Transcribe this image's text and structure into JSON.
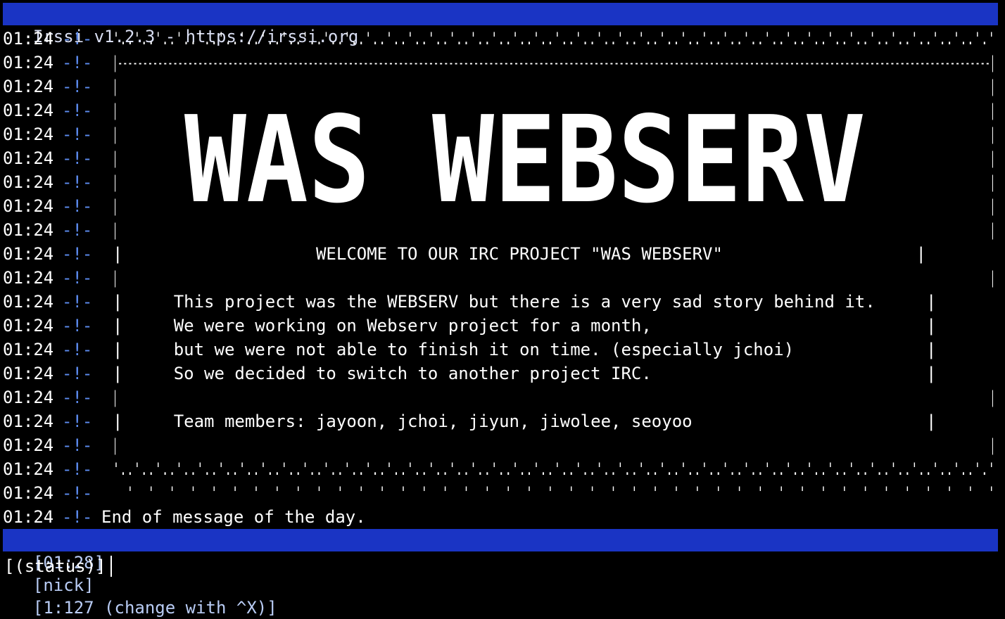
{
  "window": {
    "title": "Irssi v1.2.3 - https://irssi.org"
  },
  "log": {
    "symbol": "-!-",
    "lines": [
      {
        "time": "01:24",
        "text": "'..'..'..'..'..'..'..'..'..'..'..'..'..'..'..'..'..'..'..'..'..'..'..'..'..'..'..'..'..'..'..'..'..'..'..'..'..'..'..'..'..'.'"
      },
      {
        "time": "01:24",
        "text": "|------------------------------------------------------------------------------------------------------------------------------------------------------------------------------|"
      },
      {
        "time": "01:24",
        "text": "|                                                                                                                                                                              |"
      },
      {
        "time": "01:24",
        "text": "|                                                                                                                                                                              |"
      },
      {
        "time": "01:24",
        "text": "|                                                                                                                                                                              |"
      },
      {
        "time": "01:24",
        "text": "|                                                                                                                                                                              |"
      },
      {
        "time": "01:24",
        "text": "|                                                                                                                                                                              |"
      },
      {
        "time": "01:24",
        "text": "|                                                                                                                                                                              |"
      },
      {
        "time": "01:24",
        "text": "|                                                                                                                                                                              |"
      },
      {
        "time": "01:24",
        "text": "|                   WELCOME TO OUR IRC PROJECT \"WAS WEBSERV\"                   |"
      },
      {
        "time": "01:24",
        "text": "|                                                                                                                                                                              |"
      },
      {
        "time": "01:24",
        "text": "|     This project was the WEBSERV but there is a very sad story behind it.     |"
      },
      {
        "time": "01:24",
        "text": "|     We were working on Webserv project for a month,                           |"
      },
      {
        "time": "01:24",
        "text": "|     but we were not able to finish it on time. (especially jchoi)             |"
      },
      {
        "time": "01:24",
        "text": "|     So we decided to switch to another project IRC.                           |"
      },
      {
        "time": "01:24",
        "text": "|                                                                                                                                                                              |"
      },
      {
        "time": "01:24",
        "text": "|     Team members: jayoon, jchoi, jiyun, jiwolee, seoyoo                       |"
      },
      {
        "time": "01:24",
        "text": "|                                                                                                                                                                              |"
      },
      {
        "time": "01:24",
        "text": "'..'..'..'..'..'..'..'..'..'..'..'..'..'..'..'..'..'..'..'..'..'..'..'..'..'..'..'..'..'..'..'..'..'..'..'..'..'..'..'..'..'.'"
      },
      {
        "time": "01:24",
        "text": "  '  '  '  '  '  '  '  '  '  '  '  '  '  '  '  '  '  '  '  '  '  '  '  '  '  '  '  '  '  '  '  '  '  '  '  '  '  '  '  '  '  '"
      },
      {
        "time": "01:24",
        "text": "End of message of the day."
      }
    ]
  },
  "banner": {
    "text": "WAS WEBSERV"
  },
  "statusbar": {
    "clock": "[01:28]",
    "nick": "[nick]",
    "window": "[1:127 (change with ^X)]"
  },
  "input": {
    "prompt": "[(status)]"
  },
  "colors": {
    "bar": "#1a34c4",
    "symbol": "#5d8cf0",
    "background": "#000000",
    "text": "#ffffff"
  }
}
